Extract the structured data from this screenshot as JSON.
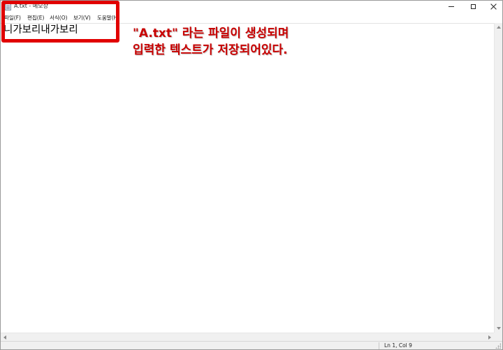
{
  "window": {
    "title": "A.txt - 메모장"
  },
  "menu": {
    "items": [
      {
        "label": "파일(F)"
      },
      {
        "label": "편집(E)"
      },
      {
        "label": "서식(O)"
      },
      {
        "label": "보기(V)"
      },
      {
        "label": "도움말(H)"
      }
    ]
  },
  "editor": {
    "content": "니가보리내가보리"
  },
  "annotation": {
    "line1_quoted": "\"A.txt\"",
    "line1_rest": " 라는 파일이 생성되며",
    "line2": "입력한 텍스트가 저장되어있다.",
    "color": "#c80000",
    "highlight_color": "#e10000"
  },
  "statusbar": {
    "position": "Ln 1, Col 9"
  },
  "icons": {
    "app": "notepad-icon",
    "minimize": "minimize-icon",
    "maximize": "maximize-icon",
    "close": "close-icon"
  }
}
